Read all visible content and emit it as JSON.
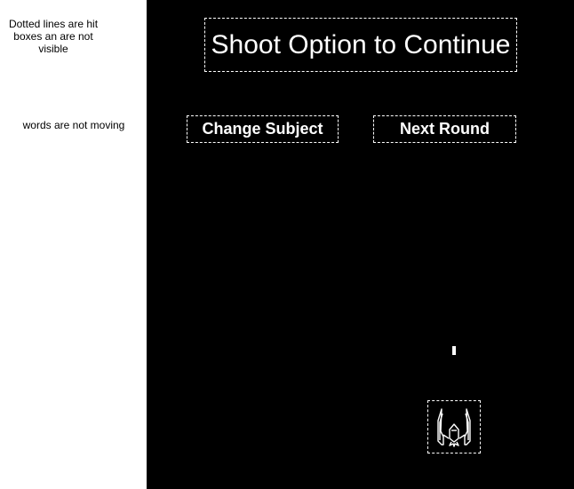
{
  "annotations": {
    "hitboxes_note": "Dotted lines are hit boxes an are not visible",
    "static_words_note": "words are not moving"
  },
  "game": {
    "title": "Shoot Option to Continue",
    "options": [
      {
        "label": "Change Subject"
      },
      {
        "label": "Next Round"
      }
    ],
    "player_icon": "spaceship-icon",
    "projectile_icon": "laser-bolt-icon"
  },
  "colors": {
    "background": "#000000",
    "foreground": "#ffffff",
    "panel": "#ffffff"
  }
}
